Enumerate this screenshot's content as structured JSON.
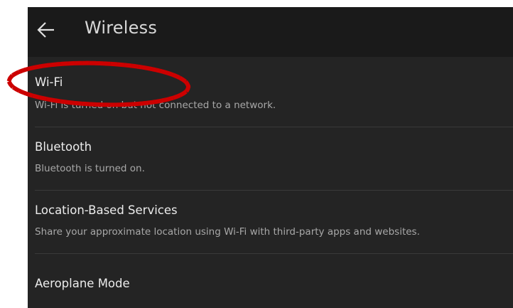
{
  "header": {
    "title": "Wireless",
    "back_icon": "arrow-left-icon"
  },
  "settings": [
    {
      "label": "Wi-Fi",
      "description": "Wi-Fi is turned on but not connected to a network."
    },
    {
      "label": "Bluetooth",
      "description": "Bluetooth is turned on."
    },
    {
      "label": "Location-Based Services",
      "description": "Share your approximate location using Wi-Fi with third-party apps and websites."
    },
    {
      "label": "Aeroplane Mode",
      "description": ""
    }
  ],
  "colors": {
    "background": "#242424",
    "appbar": "#1a1a1a",
    "highlight": "#cc0000"
  },
  "annotation": {
    "shape": "dotted-ellipse",
    "target": "Wi-Fi"
  }
}
